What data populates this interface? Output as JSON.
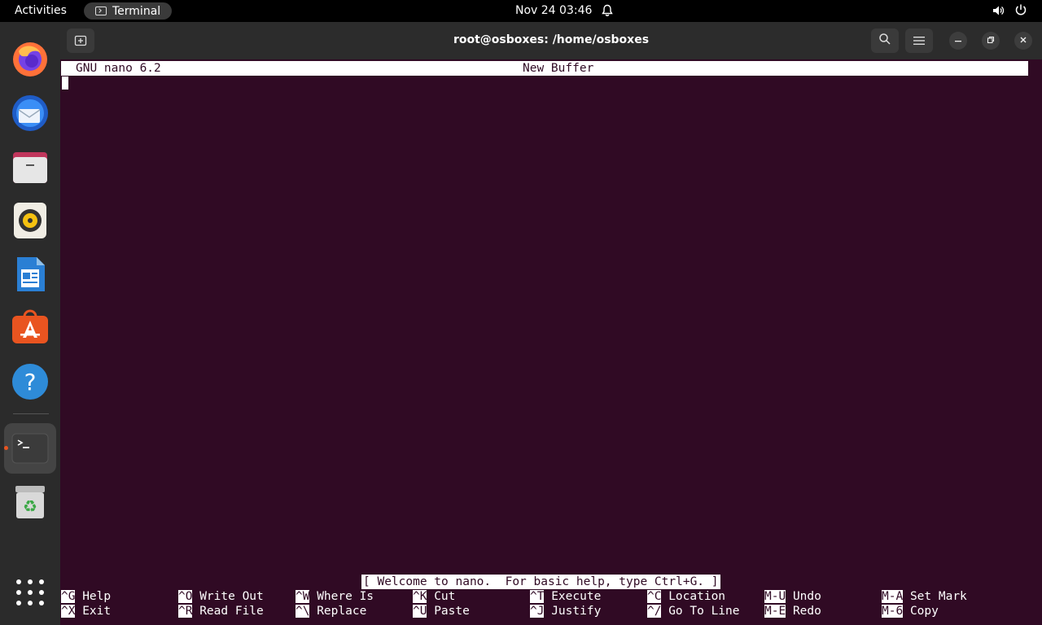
{
  "topbar": {
    "activities": "Activities",
    "app_name": "Terminal",
    "clock": "Nov 24  03:46"
  },
  "dock": {
    "items": [
      "firefox-icon",
      "thunderbird-icon",
      "files-icon",
      "rhythmbox-icon",
      "writer-icon",
      "software-icon",
      "help-icon",
      "terminal-icon",
      "trash-icon",
      "app-grid-icon"
    ],
    "accent": "#e95420"
  },
  "window": {
    "title": "root@osboxes: /home/osboxes"
  },
  "nano": {
    "version": "GNU nano 6.2",
    "buffer": "New Buffer",
    "status": "[ Welcome to nano.  For basic help, type Ctrl+G. ]",
    "background": "#300a24",
    "shortcuts_row1": [
      {
        "key": "^G",
        "label": "Help"
      },
      {
        "key": "^O",
        "label": "Write Out"
      },
      {
        "key": "^W",
        "label": "Where Is"
      },
      {
        "key": "^K",
        "label": "Cut"
      },
      {
        "key": "^T",
        "label": "Execute"
      },
      {
        "key": "^C",
        "label": "Location"
      },
      {
        "key": "M-U",
        "label": "Undo"
      },
      {
        "key": "M-A",
        "label": "Set Mark"
      }
    ],
    "shortcuts_row2": [
      {
        "key": "^X",
        "label": "Exit"
      },
      {
        "key": "^R",
        "label": "Read File"
      },
      {
        "key": "^\\",
        "label": "Replace"
      },
      {
        "key": "^U",
        "label": "Paste"
      },
      {
        "key": "^J",
        "label": "Justify"
      },
      {
        "key": "^/",
        "label": "Go To Line"
      },
      {
        "key": "M-E",
        "label": "Redo"
      },
      {
        "key": "M-6",
        "label": "Copy"
      }
    ]
  }
}
